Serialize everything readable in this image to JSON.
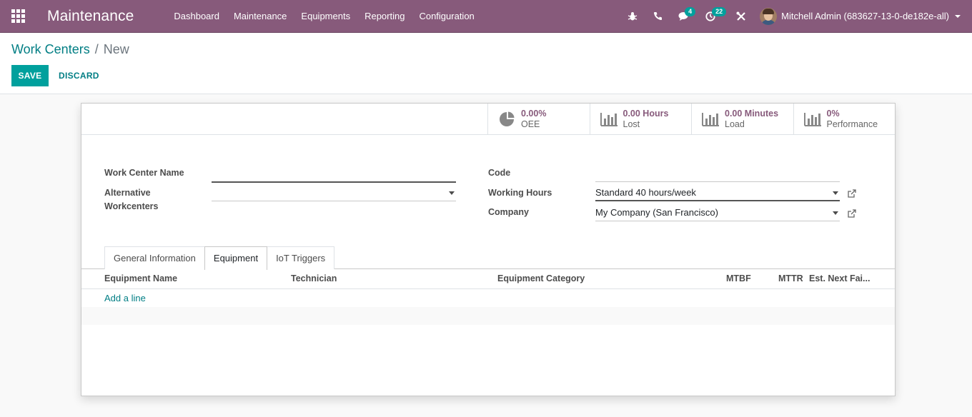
{
  "navbar": {
    "app_title": "Maintenance",
    "menu": [
      "Dashboard",
      "Maintenance",
      "Equipments",
      "Reporting",
      "Configuration"
    ],
    "messages_badge": "4",
    "activities_badge": "22",
    "user_name": "Mitchell Admin (683627-13-0-de182e-all)",
    "icons": [
      "apps-grid-icon",
      "bug-icon",
      "phone-icon",
      "chat-icon",
      "clock-icon",
      "tools-icon"
    ]
  },
  "breadcrumb": {
    "parent": "Work Centers",
    "separator": "/",
    "current": "New"
  },
  "buttons": {
    "save": "SAVE",
    "discard": "DISCARD"
  },
  "stats": [
    {
      "value": "0.00%",
      "label": "OEE",
      "icon": "pie-chart-icon"
    },
    {
      "value": "0.00 Hours",
      "label": "Lost",
      "icon": "bar-chart-icon"
    },
    {
      "value": "0.00 Minutes",
      "label": "Load",
      "icon": "bar-chart-icon"
    },
    {
      "value": "0%",
      "label": "Performance",
      "icon": "bar-chart-icon"
    }
  ],
  "form": {
    "work_center_name_label": "Work Center Name",
    "work_center_name_value": "",
    "alternative_label_1": "Alternative",
    "alternative_label_2": "Workcenters",
    "alternative_value": "",
    "code_label": "Code",
    "code_value": "",
    "working_hours_label": "Working Hours",
    "working_hours_value": "Standard 40 hours/week",
    "company_label": "Company",
    "company_value": "My Company (San Francisco)"
  },
  "tabs": [
    "General Information",
    "Equipment",
    "IoT Triggers"
  ],
  "active_tab": "Equipment",
  "table": {
    "columns": [
      "Equipment Name",
      "Technician",
      "Equipment Category",
      "MTBF",
      "MTTR",
      "Est. Next Fai..."
    ],
    "add_line": "Add a line"
  },
  "colors": {
    "navbar": "#875a7b",
    "primary": "#00a09d",
    "link": "#017e84",
    "stat_value": "#875a7b"
  }
}
